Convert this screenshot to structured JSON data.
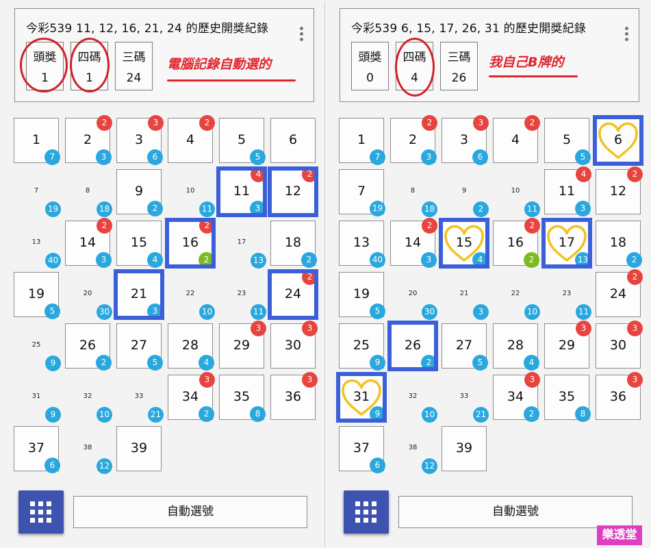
{
  "left_panel": {
    "title": "今彩539 11, 12, 16, 21, 24 的歷史開獎紀錄",
    "stats": [
      {
        "label": "頭獎",
        "value": "1"
      },
      {
        "label": "四碼",
        "value": "1"
      },
      {
        "label": "三碼",
        "value": "24"
      }
    ],
    "note": "電腦記錄自動選的",
    "auto_button": "自動選號",
    "grid": [
      {
        "n": "1",
        "boxed": true,
        "blue": "7"
      },
      {
        "n": "2",
        "boxed": true,
        "blue": "3",
        "red": "2"
      },
      {
        "n": "3",
        "boxed": true,
        "blue": "6",
        "red": "3"
      },
      {
        "n": "4",
        "boxed": true,
        "red": "2"
      },
      {
        "n": "5",
        "boxed": true,
        "blue": "5"
      },
      {
        "n": "6",
        "boxed": true
      },
      {
        "n": "7",
        "boxed": false,
        "blue": "19"
      },
      {
        "n": "8",
        "boxed": false,
        "blue": "18"
      },
      {
        "n": "9",
        "boxed": true,
        "blue": "2"
      },
      {
        "n": "10",
        "boxed": false,
        "blue": "11"
      },
      {
        "n": "11",
        "boxed": true,
        "blue": "3",
        "red": "4",
        "selected": true
      },
      {
        "n": "12",
        "boxed": true,
        "red": "2",
        "selected": true
      },
      {
        "n": "13",
        "boxed": false,
        "blue": "40"
      },
      {
        "n": "14",
        "boxed": true,
        "blue": "3",
        "red": "2"
      },
      {
        "n": "15",
        "boxed": true,
        "blue": "4"
      },
      {
        "n": "16",
        "boxed": true,
        "blue": "2",
        "blue_green": true,
        "red": "2",
        "selected": true
      },
      {
        "n": "17",
        "boxed": false,
        "blue": "13"
      },
      {
        "n": "18",
        "boxed": true,
        "blue": "2"
      },
      {
        "n": "19",
        "boxed": true,
        "blue": "5"
      },
      {
        "n": "20",
        "boxed": false,
        "blue": "30"
      },
      {
        "n": "21",
        "boxed": true,
        "blue": "3",
        "selected": true
      },
      {
        "n": "22",
        "boxed": false,
        "blue": "10"
      },
      {
        "n": "23",
        "boxed": false,
        "blue": "11"
      },
      {
        "n": "24",
        "boxed": true,
        "red": "2",
        "selected": true
      },
      {
        "n": "25",
        "boxed": false,
        "blue": "9"
      },
      {
        "n": "26",
        "boxed": true,
        "blue": "2"
      },
      {
        "n": "27",
        "boxed": true,
        "blue": "5"
      },
      {
        "n": "28",
        "boxed": true,
        "blue": "4"
      },
      {
        "n": "29",
        "boxed": true,
        "red": "3"
      },
      {
        "n": "30",
        "boxed": true,
        "red": "3"
      },
      {
        "n": "31",
        "boxed": false,
        "blue": "9"
      },
      {
        "n": "32",
        "boxed": false,
        "blue": "10"
      },
      {
        "n": "33",
        "boxed": false,
        "blue": "21"
      },
      {
        "n": "34",
        "boxed": true,
        "blue": "2",
        "red": "3"
      },
      {
        "n": "35",
        "boxed": true,
        "blue": "8"
      },
      {
        "n": "36",
        "boxed": true,
        "red": "3"
      },
      {
        "n": "37",
        "boxed": true,
        "blue": "6"
      },
      {
        "n": "38",
        "boxed": false,
        "blue": "12"
      },
      {
        "n": "39",
        "boxed": true
      }
    ]
  },
  "right_panel": {
    "title": "今彩539 6, 15, 17, 26, 31 的歷史開獎紀錄",
    "stats": [
      {
        "label": "頭獎",
        "value": "0"
      },
      {
        "label": "四碼",
        "value": "4"
      },
      {
        "label": "三碼",
        "value": "26"
      }
    ],
    "note": "我自己B牌的",
    "auto_button": "自動選號",
    "grid": [
      {
        "n": "1",
        "boxed": true,
        "blue": "7"
      },
      {
        "n": "2",
        "boxed": true,
        "blue": "3",
        "red": "2"
      },
      {
        "n": "3",
        "boxed": true,
        "blue": "6",
        "red": "3"
      },
      {
        "n": "4",
        "boxed": true,
        "red": "2"
      },
      {
        "n": "5",
        "boxed": true,
        "blue": "5"
      },
      {
        "n": "6",
        "boxed": true,
        "selected": true,
        "heart": true
      },
      {
        "n": "7",
        "boxed": true,
        "blue": "19"
      },
      {
        "n": "8",
        "boxed": false,
        "blue": "18"
      },
      {
        "n": "9",
        "boxed": false,
        "blue": "2"
      },
      {
        "n": "10",
        "boxed": false,
        "blue": "11"
      },
      {
        "n": "11",
        "boxed": true,
        "blue": "3",
        "red": "4"
      },
      {
        "n": "12",
        "boxed": true,
        "red": "2"
      },
      {
        "n": "13",
        "boxed": true,
        "blue": "40"
      },
      {
        "n": "14",
        "boxed": true,
        "blue": "3",
        "red": "2"
      },
      {
        "n": "15",
        "boxed": true,
        "blue": "4",
        "selected": true,
        "heart": true
      },
      {
        "n": "16",
        "boxed": true,
        "blue": "2",
        "blue_green": true,
        "red": "2"
      },
      {
        "n": "17",
        "boxed": true,
        "blue": "13",
        "selected": true,
        "heart": true
      },
      {
        "n": "18",
        "boxed": true,
        "blue": "2"
      },
      {
        "n": "19",
        "boxed": true,
        "blue": "5"
      },
      {
        "n": "20",
        "boxed": false,
        "blue": "30"
      },
      {
        "n": "21",
        "boxed": false,
        "blue": "3"
      },
      {
        "n": "22",
        "boxed": false,
        "blue": "10"
      },
      {
        "n": "23",
        "boxed": false,
        "blue": "11"
      },
      {
        "n": "24",
        "boxed": true,
        "red": "2"
      },
      {
        "n": "25",
        "boxed": true,
        "blue": "9"
      },
      {
        "n": "26",
        "boxed": true,
        "blue": "2",
        "selected": true
      },
      {
        "n": "27",
        "boxed": true,
        "blue": "5"
      },
      {
        "n": "28",
        "boxed": true,
        "blue": "4"
      },
      {
        "n": "29",
        "boxed": true,
        "red": "3"
      },
      {
        "n": "30",
        "boxed": true,
        "red": "3"
      },
      {
        "n": "31",
        "boxed": true,
        "blue": "9",
        "selected": true,
        "heart": true
      },
      {
        "n": "32",
        "boxed": false,
        "blue": "10"
      },
      {
        "n": "33",
        "boxed": false,
        "blue": "21"
      },
      {
        "n": "34",
        "boxed": true,
        "blue": "2",
        "red": "3"
      },
      {
        "n": "35",
        "boxed": true,
        "blue": "8"
      },
      {
        "n": "36",
        "boxed": true,
        "red": "3"
      },
      {
        "n": "37",
        "boxed": true,
        "blue": "6"
      },
      {
        "n": "38",
        "boxed": false,
        "blue": "12"
      },
      {
        "n": "39",
        "boxed": true
      }
    ]
  },
  "brand": "樂透堂",
  "colors": {
    "red_badge": "#e8443f",
    "blue_badge": "#2aa8de",
    "green_badge": "#7cbc22",
    "selection_border": "#3b5fd8",
    "note_red": "#e0252f",
    "heart_yellow": "#f2c21b",
    "fab_blue": "#3e53b0",
    "brand_magenta": "#dd3fc0"
  },
  "icons": {
    "menu": "kebab-vertical-icon",
    "grid_button": "grid-3x3-icon",
    "favorite": "heart-outline-icon"
  }
}
